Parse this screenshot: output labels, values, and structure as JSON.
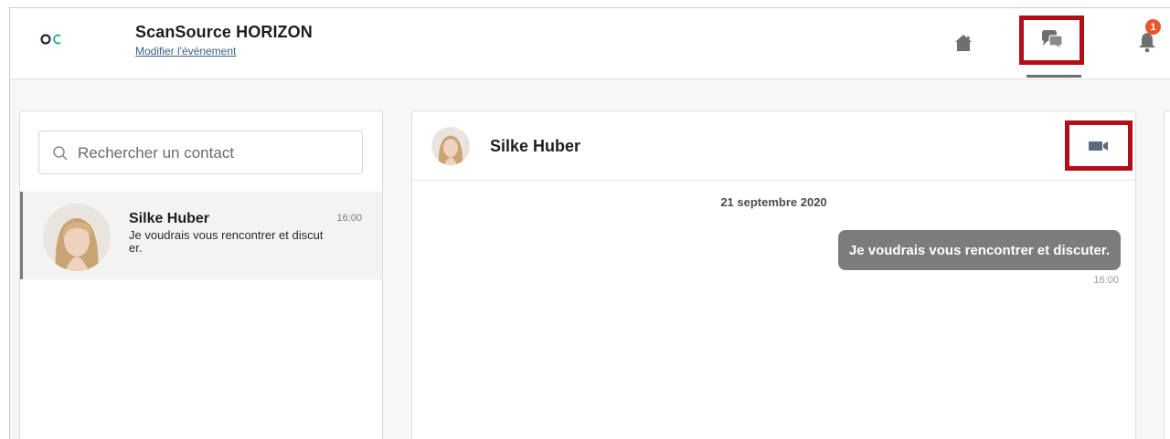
{
  "header": {
    "title": "ScanSource HORIZON",
    "edit_link": "Modifier l'événement",
    "notification_count": "1",
    "logo_icon": "oc-logo-icon",
    "home_icon": "home-icon",
    "chat_icon": "chat-bubbles-icon",
    "bell_icon": "bell-icon"
  },
  "contacts": {
    "search_placeholder": "Rechercher un contact",
    "items": [
      {
        "name": "Silke Huber",
        "time": "16:00",
        "preview": "Je voudrais vous rencontrer et discuter."
      }
    ]
  },
  "conversation": {
    "contact_name": "Silke Huber",
    "video_icon": "video-camera-icon",
    "date": "21 septembre 2020",
    "messages": [
      {
        "text": "Je voudrais vous rencontrer et discuter.",
        "time": "16:00"
      }
    ]
  },
  "colors": {
    "highlight_border": "#b30d1a",
    "badge": "#e8562a",
    "bubble": "#7c7c7c",
    "icon_gray": "#6f6f6f"
  }
}
